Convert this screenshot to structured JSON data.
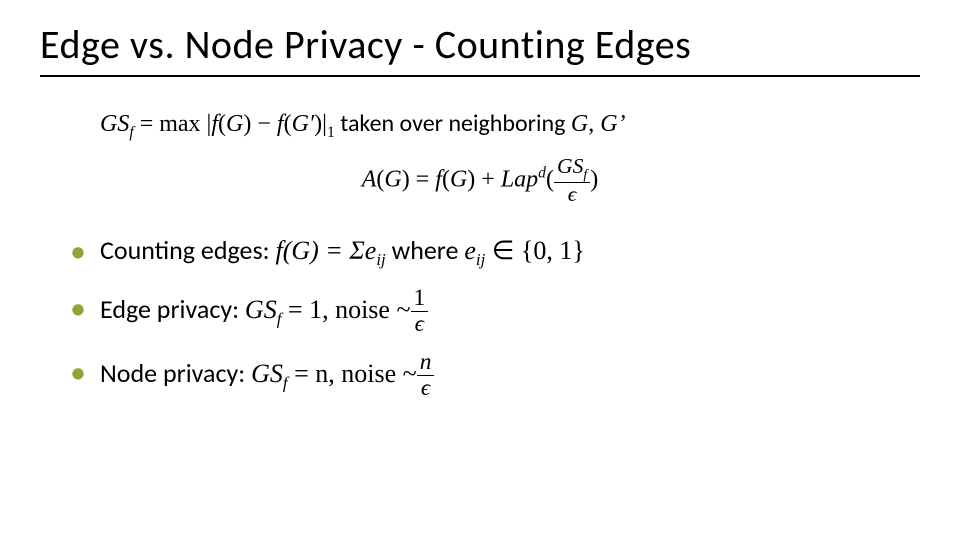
{
  "title": "Edge vs. Node Privacy - Counting Edges",
  "eq1": {
    "lhs_base": "GS",
    "lhs_sub": "f",
    "eq": " = max |",
    "f": "f",
    "G": "G",
    "minus": ") − ",
    "Gp": "G′",
    "close": ")|",
    "one": "1",
    "tail_plain": " taken over neighboring ",
    "tail_math": "G, G’"
  },
  "eq2": {
    "A": "A",
    "G": "G",
    "eq": ") = ",
    "f": "f",
    "plus": ") + ",
    "Lap": "Lap",
    "d": "d",
    "open": "(",
    "frac_num_base": "GS",
    "frac_num_sub": "f",
    "frac_den": "ϵ",
    "close": ")"
  },
  "bullets": {
    "b1": {
      "label": "Counting edges: ",
      "fg": "f(G) =  Σe",
      "ij1": "ij",
      "where": " where ",
      "e2": "e",
      "ij2": "ij",
      "inset": " ∈ {0, 1}"
    },
    "b2": {
      "label": "Edge privacy: ",
      "gs": "GS",
      "fsub": "f",
      "eq": " = 1, noise ~",
      "num": "1",
      "den": "ϵ"
    },
    "b3": {
      "label": "Node privacy: ",
      "gs": "GS",
      "fsub": "f",
      "eq": " = n, noise ~",
      "num": "n",
      "den": "ϵ"
    }
  }
}
